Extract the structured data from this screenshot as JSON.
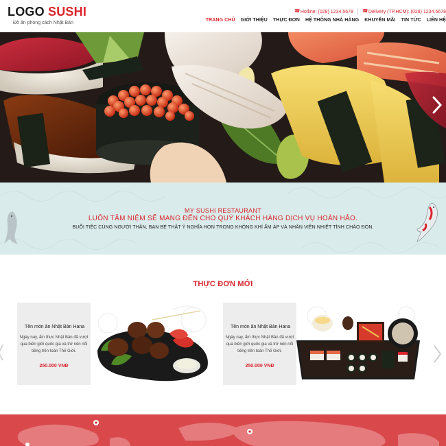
{
  "header": {
    "logo_part1": "LOGO",
    "logo_part2": "SUSHI",
    "tagline": "Đồ ăn phong cách Nhật Bản",
    "hotline": "Hotline: (028) 1234.5678",
    "delivery": "Delivery (TP.HCM): (028) 1234.5678",
    "nav": [
      {
        "label": "TRANG CHỦ",
        "active": true
      },
      {
        "label": "GIỚI THIỆU",
        "active": false
      },
      {
        "label": "THỰC ĐƠN",
        "active": false
      },
      {
        "label": "HỆ THỐNG NHÀ HÀNG",
        "active": false
      },
      {
        "label": "KHUYẾN MÃI",
        "active": false
      },
      {
        "label": "TIN TỨC",
        "active": false
      },
      {
        "label": "LIÊN HỆ",
        "active": false
      }
    ]
  },
  "banner": {
    "line1": "MY SUSHI RESTAURANT",
    "line2": "LUÔN TÂM NIỆM SẼ MANG ĐẾN CHO QUÝ KHÁCH HÀNG DỊCH VỤ HOÀN HẢO.",
    "line3": "BUỔI TIỆC CÙNG NGƯỜI THÂN, BẠN BÈ THẬT Ý NGHĨA HƠN TRONG KHÔNG KHÍ ẤM ÁP VÀ NHÂN VIÊN NHIỆT TÌNH CHÀO ĐÓN."
  },
  "menu": {
    "title": "THỰC ĐƠN MỚI",
    "items": [
      {
        "name": "Tên món ăn Nhật Bản Hana",
        "description": "Ngày nay, ẩm thực Nhật Bản đã vượt qua biên giới quốc gia và trở nên nổi tiếng trên toàn Thế Giới.",
        "price": "250.000 VNĐ"
      },
      {
        "name": "Tên món ăn Nhật Bản Hana",
        "description": "Ngày nay, ẩm thực Nhật Bản đã vượt qua biên giới quốc gia và trở nên nổi tiếng trên toàn Thế Giới.",
        "price": "250.000 VNĐ"
      }
    ]
  },
  "colors": {
    "accent": "#d9242c",
    "banner_bg": "#d9ebea",
    "map_bg": "#d9484a"
  },
  "icons": [
    "phone-icon",
    "chevron-right-icon",
    "chevron-left-icon",
    "koi-fish-icon"
  ]
}
